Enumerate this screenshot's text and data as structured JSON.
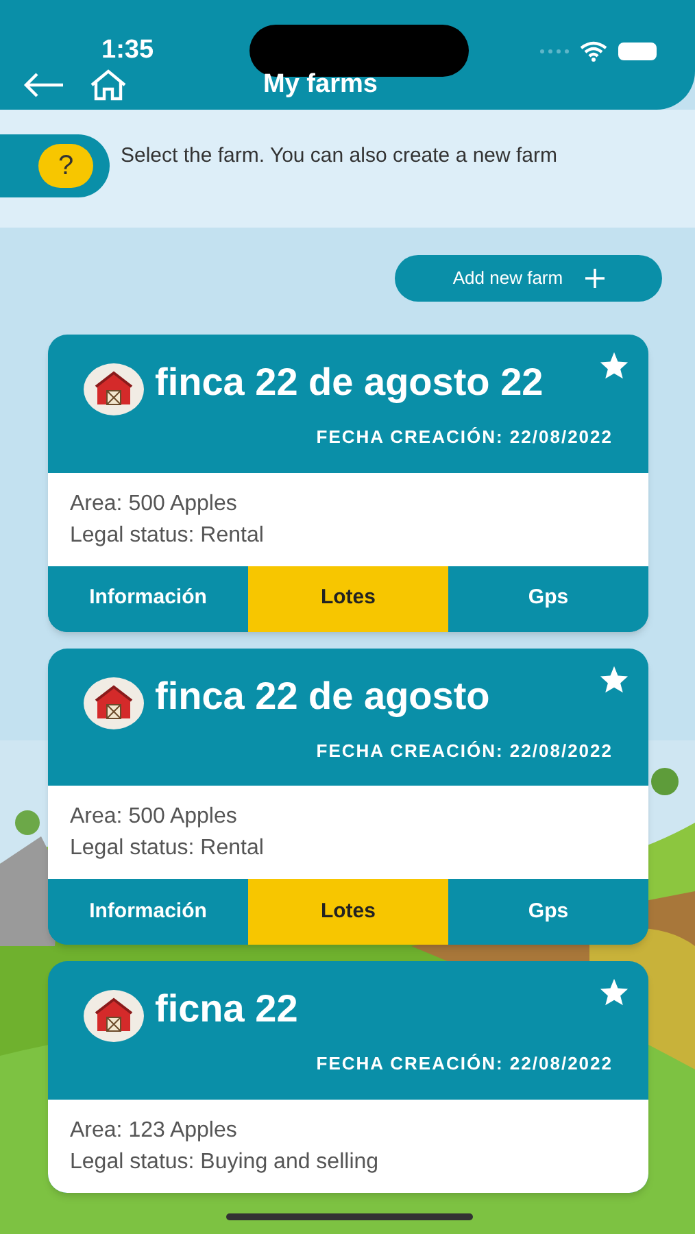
{
  "status_bar": {
    "time": "1:35"
  },
  "header": {
    "title": "My farms"
  },
  "help": {
    "icon_text": "?",
    "message": "Select the farm. You can also create a new farm"
  },
  "add_button": {
    "label": "Add new farm"
  },
  "farms": [
    {
      "name": "finca 22 de agosto 22",
      "date": "FECHA CREACIÓN: 22/08/2022",
      "area": "Area: 500 Apples",
      "legal": "Legal status: Rental",
      "tabs": [
        {
          "label": "Información",
          "selected": false
        },
        {
          "label": "Lotes",
          "selected": true
        },
        {
          "label": "Gps",
          "selected": false
        }
      ]
    },
    {
      "name": "finca 22 de agosto",
      "date": "FECHA CREACIÓN: 22/08/2022",
      "area": "Area: 500 Apples",
      "legal": "Legal status: Rental",
      "tabs": [
        {
          "label": "Información",
          "selected": false
        },
        {
          "label": "Lotes",
          "selected": true
        },
        {
          "label": "Gps",
          "selected": false
        }
      ]
    },
    {
      "name": "ficna 22",
      "date": "FECHA CREACIÓN: 22/08/2022",
      "area": "Area: 123 Apples",
      "legal": "Legal status: Buying and selling"
    }
  ]
}
